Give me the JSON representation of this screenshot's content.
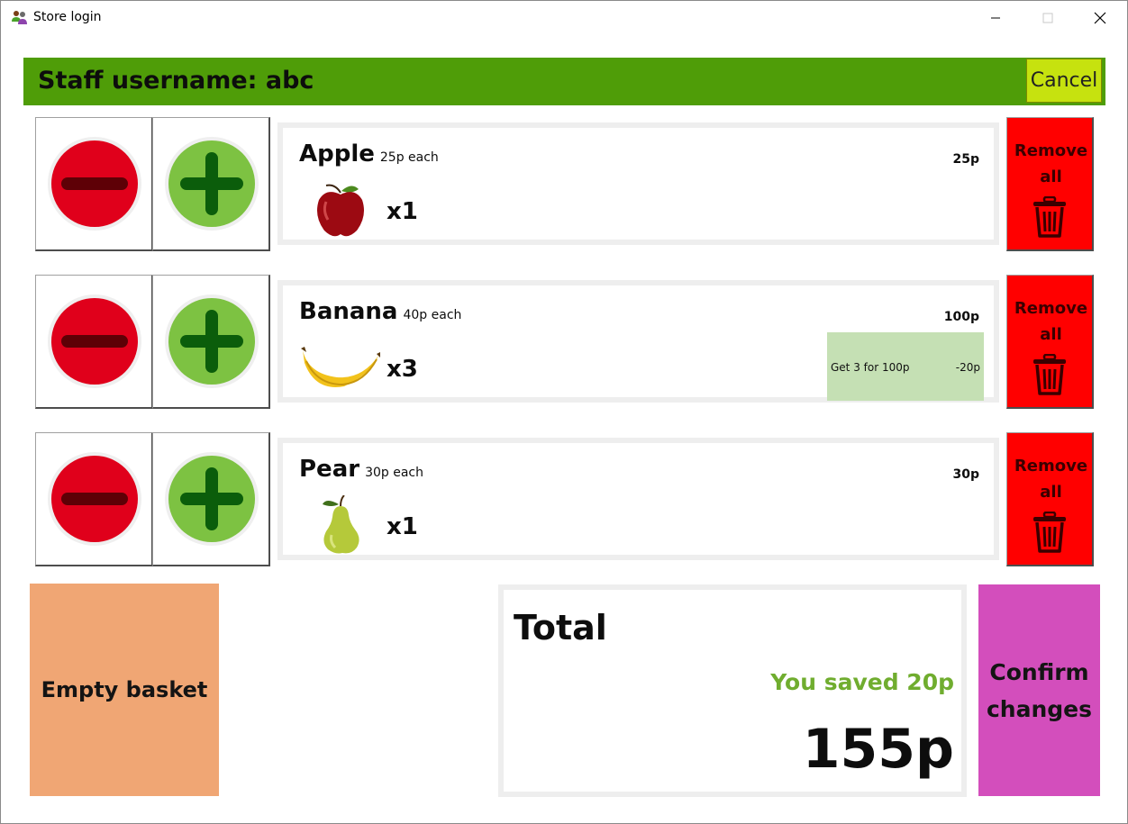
{
  "window": {
    "title": "Store login",
    "controls": {
      "minimize": "—",
      "maximize": "☐",
      "close": "✕"
    }
  },
  "header": {
    "staff_label": "Staff username: abc",
    "cancel_label": "Cancel",
    "bar_color": "#4f9d08",
    "cancel_color": "#c6e20f"
  },
  "items": [
    {
      "name": "Apple",
      "each": "25p each",
      "line_total": "25p",
      "qty": "x1",
      "image_icon": "apple-icon",
      "offer": null,
      "remove_label_1": "Remove",
      "remove_label_2": "all"
    },
    {
      "name": "Banana",
      "each": "40p each",
      "line_total": "100p",
      "qty": "x3",
      "image_icon": "banana-icon",
      "offer": {
        "label": "Get 3 for 100p",
        "amount": "-20p"
      },
      "remove_label_1": "Remove",
      "remove_label_2": "all"
    },
    {
      "name": "Pear",
      "each": "30p each",
      "line_total": "30p",
      "qty": "x1",
      "image_icon": "pear-icon",
      "offer": null,
      "remove_label_1": "Remove",
      "remove_label_2": "all"
    }
  ],
  "footer": {
    "empty_basket_label": "Empty basket",
    "total_title": "Total",
    "saved_text": "You saved 20p",
    "total_amount": "155p",
    "confirm_line_1": "Confirm",
    "confirm_line_2": "changes"
  },
  "colors": {
    "remove_red": "#ff0000",
    "minus_red": "#e0001b",
    "plus_green": "#7dc242",
    "offer_green": "#c5e0b4",
    "saved_green": "#70ad2f",
    "empty_orange": "#f0a674",
    "confirm_magenta": "#d34ebc"
  }
}
